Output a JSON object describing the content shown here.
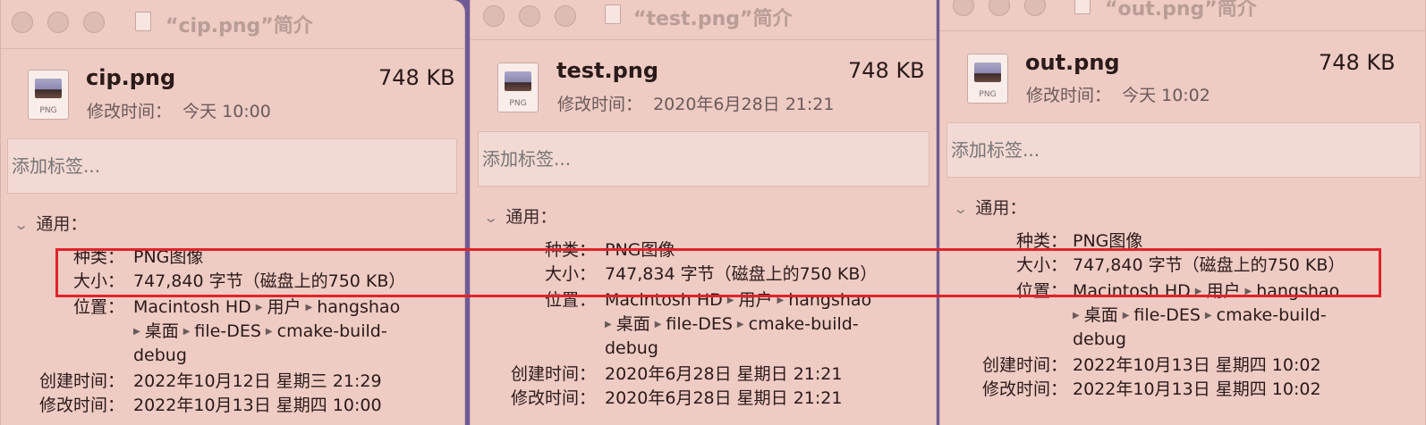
{
  "windows": [
    {
      "title": "“cip.png”简介",
      "file_name": "cip.png",
      "file_size": "748 KB",
      "modified_label": "修改时间：",
      "modified_value": "今天 10:00",
      "icon_ext": "PNG",
      "tag_placeholder": "添加标签...",
      "section": "通用：",
      "kind_label": "种类：",
      "kind_value": "PNG图像",
      "size_label": "大小：",
      "size_value": "747,840 字节（磁盘上的750 KB）",
      "where_label": "位置：",
      "where_line1": [
        "Macintosh HD",
        "用户",
        "hangshao"
      ],
      "where_line2": [
        "桌面",
        "file-DES",
        "cmake-build-"
      ],
      "where_line3": "debug",
      "created_label": "创建时间：",
      "created_value": "2022年10月12日 星期三 21:29",
      "modified2_label": "修改时间：",
      "modified2_value": "2022年10月13日 星期四 10:00"
    },
    {
      "title": "“test.png”简介",
      "file_name": "test.png",
      "file_size": "748 KB",
      "modified_label": "修改时间：",
      "modified_value": "2020年6月28日 21:21",
      "icon_ext": "PNG",
      "tag_placeholder": "添加标签...",
      "section": "通用：",
      "kind_label": "种类：",
      "kind_value": "PNG图像",
      "size_label": "大小：",
      "size_value": "747,834 字节（磁盘上的750 KB）",
      "where_label": "位置：",
      "where_line1": [
        "Macintosh HD",
        "用户",
        "hangshao"
      ],
      "where_line2": [
        "桌面",
        "file-DES",
        "cmake-build-"
      ],
      "where_line3": "debug",
      "created_label": "创建时间：",
      "created_value": "2020年6月28日 星期日 21:21",
      "modified2_label": "修改时间：",
      "modified2_value": "2020年6月28日 星期日 21:21"
    },
    {
      "title": "“out.png”简介",
      "file_name": "out.png",
      "file_size": "748 KB",
      "modified_label": "修改时间：",
      "modified_value": "今天 10:02",
      "icon_ext": "PNG",
      "tag_placeholder": "添加标签...",
      "section": "通用：",
      "kind_label": "种类：",
      "kind_value": "PNG图像",
      "size_label": "大小：",
      "size_value": "747,840 字节（磁盘上的750 KB）",
      "where_label": "位置：",
      "where_line1": [
        "Macintosh HD",
        "用户",
        "hangshao"
      ],
      "where_line2": [
        "桌面",
        "file-DES",
        "cmake-build-"
      ],
      "where_line3": "debug",
      "created_label": "创建时间：",
      "created_value": "2022年10月13日 星期四 10:02",
      "modified2_label": "修改时间：",
      "modified2_value": "2022年10月13日 星期四 10:02"
    }
  ],
  "colors": {
    "window_bg": "#eecbc3",
    "highlight_box": "#e0232b",
    "desktop_bg": "#6e5a96"
  },
  "icons": {
    "traffic_light": "circle",
    "disclosure": "chevron-down-icon",
    "path_separator": "triangle-right-icon",
    "file": "png-file-icon"
  }
}
